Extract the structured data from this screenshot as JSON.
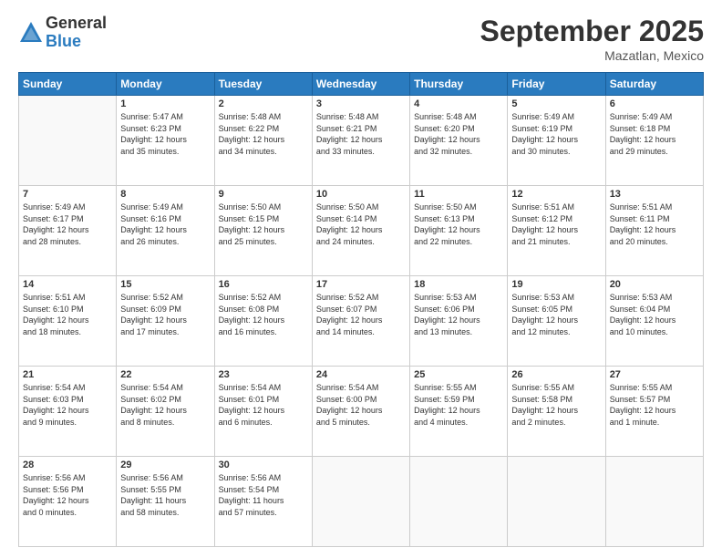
{
  "logo": {
    "general": "General",
    "blue": "Blue"
  },
  "header": {
    "month": "September 2025",
    "location": "Mazatlan, Mexico"
  },
  "weekdays": [
    "Sunday",
    "Monday",
    "Tuesday",
    "Wednesday",
    "Thursday",
    "Friday",
    "Saturday"
  ],
  "weeks": [
    [
      {
        "day": "",
        "info": ""
      },
      {
        "day": "1",
        "info": "Sunrise: 5:47 AM\nSunset: 6:23 PM\nDaylight: 12 hours\nand 35 minutes."
      },
      {
        "day": "2",
        "info": "Sunrise: 5:48 AM\nSunset: 6:22 PM\nDaylight: 12 hours\nand 34 minutes."
      },
      {
        "day": "3",
        "info": "Sunrise: 5:48 AM\nSunset: 6:21 PM\nDaylight: 12 hours\nand 33 minutes."
      },
      {
        "day": "4",
        "info": "Sunrise: 5:48 AM\nSunset: 6:20 PM\nDaylight: 12 hours\nand 32 minutes."
      },
      {
        "day": "5",
        "info": "Sunrise: 5:49 AM\nSunset: 6:19 PM\nDaylight: 12 hours\nand 30 minutes."
      },
      {
        "day": "6",
        "info": "Sunrise: 5:49 AM\nSunset: 6:18 PM\nDaylight: 12 hours\nand 29 minutes."
      }
    ],
    [
      {
        "day": "7",
        "info": "Sunrise: 5:49 AM\nSunset: 6:17 PM\nDaylight: 12 hours\nand 28 minutes."
      },
      {
        "day": "8",
        "info": "Sunrise: 5:49 AM\nSunset: 6:16 PM\nDaylight: 12 hours\nand 26 minutes."
      },
      {
        "day": "9",
        "info": "Sunrise: 5:50 AM\nSunset: 6:15 PM\nDaylight: 12 hours\nand 25 minutes."
      },
      {
        "day": "10",
        "info": "Sunrise: 5:50 AM\nSunset: 6:14 PM\nDaylight: 12 hours\nand 24 minutes."
      },
      {
        "day": "11",
        "info": "Sunrise: 5:50 AM\nSunset: 6:13 PM\nDaylight: 12 hours\nand 22 minutes."
      },
      {
        "day": "12",
        "info": "Sunrise: 5:51 AM\nSunset: 6:12 PM\nDaylight: 12 hours\nand 21 minutes."
      },
      {
        "day": "13",
        "info": "Sunrise: 5:51 AM\nSunset: 6:11 PM\nDaylight: 12 hours\nand 20 minutes."
      }
    ],
    [
      {
        "day": "14",
        "info": "Sunrise: 5:51 AM\nSunset: 6:10 PM\nDaylight: 12 hours\nand 18 minutes."
      },
      {
        "day": "15",
        "info": "Sunrise: 5:52 AM\nSunset: 6:09 PM\nDaylight: 12 hours\nand 17 minutes."
      },
      {
        "day": "16",
        "info": "Sunrise: 5:52 AM\nSunset: 6:08 PM\nDaylight: 12 hours\nand 16 minutes."
      },
      {
        "day": "17",
        "info": "Sunrise: 5:52 AM\nSunset: 6:07 PM\nDaylight: 12 hours\nand 14 minutes."
      },
      {
        "day": "18",
        "info": "Sunrise: 5:53 AM\nSunset: 6:06 PM\nDaylight: 12 hours\nand 13 minutes."
      },
      {
        "day": "19",
        "info": "Sunrise: 5:53 AM\nSunset: 6:05 PM\nDaylight: 12 hours\nand 12 minutes."
      },
      {
        "day": "20",
        "info": "Sunrise: 5:53 AM\nSunset: 6:04 PM\nDaylight: 12 hours\nand 10 minutes."
      }
    ],
    [
      {
        "day": "21",
        "info": "Sunrise: 5:54 AM\nSunset: 6:03 PM\nDaylight: 12 hours\nand 9 minutes."
      },
      {
        "day": "22",
        "info": "Sunrise: 5:54 AM\nSunset: 6:02 PM\nDaylight: 12 hours\nand 8 minutes."
      },
      {
        "day": "23",
        "info": "Sunrise: 5:54 AM\nSunset: 6:01 PM\nDaylight: 12 hours\nand 6 minutes."
      },
      {
        "day": "24",
        "info": "Sunrise: 5:54 AM\nSunset: 6:00 PM\nDaylight: 12 hours\nand 5 minutes."
      },
      {
        "day": "25",
        "info": "Sunrise: 5:55 AM\nSunset: 5:59 PM\nDaylight: 12 hours\nand 4 minutes."
      },
      {
        "day": "26",
        "info": "Sunrise: 5:55 AM\nSunset: 5:58 PM\nDaylight: 12 hours\nand 2 minutes."
      },
      {
        "day": "27",
        "info": "Sunrise: 5:55 AM\nSunset: 5:57 PM\nDaylight: 12 hours\nand 1 minute."
      }
    ],
    [
      {
        "day": "28",
        "info": "Sunrise: 5:56 AM\nSunset: 5:56 PM\nDaylight: 12 hours\nand 0 minutes."
      },
      {
        "day": "29",
        "info": "Sunrise: 5:56 AM\nSunset: 5:55 PM\nDaylight: 11 hours\nand 58 minutes."
      },
      {
        "day": "30",
        "info": "Sunrise: 5:56 AM\nSunset: 5:54 PM\nDaylight: 11 hours\nand 57 minutes."
      },
      {
        "day": "",
        "info": ""
      },
      {
        "day": "",
        "info": ""
      },
      {
        "day": "",
        "info": ""
      },
      {
        "day": "",
        "info": ""
      }
    ]
  ]
}
